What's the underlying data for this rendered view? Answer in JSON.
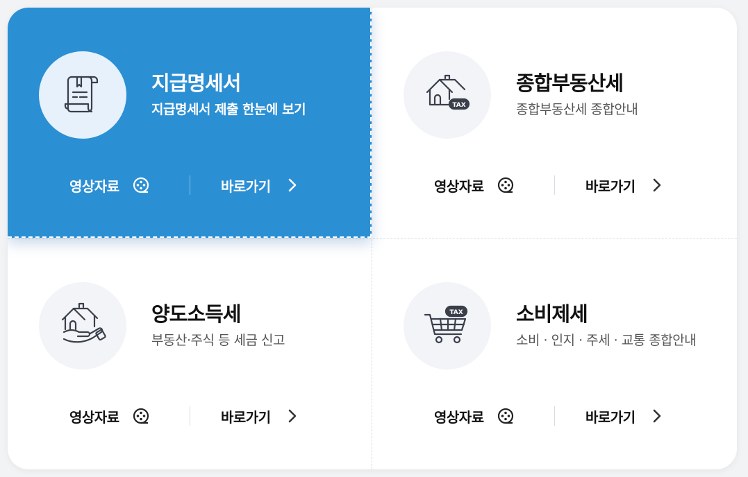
{
  "cards": [
    {
      "title": "지급명세서",
      "desc": "지급명세서 제출 한눈에 보기",
      "icon": "document-scroll-icon",
      "video_label": "영상자료",
      "go_label": "바로가기",
      "active": true
    },
    {
      "title": "종합부동산세",
      "desc": "종합부동산세 종합안내",
      "icon": "house-tax-icon",
      "tax_badge": "TAX",
      "video_label": "영상자료",
      "go_label": "바로가기",
      "active": false
    },
    {
      "title": "양도소득세",
      "desc": "부동산·주식 등 세금 신고",
      "icon": "house-in-hand-icon",
      "video_label": "영상자료",
      "go_label": "바로가기",
      "active": false
    },
    {
      "title": "소비제세",
      "desc": "소비 · 인지 · 주세 · 교통 종합안내",
      "icon": "shopping-cart-tax-icon",
      "tax_badge": "TAX",
      "video_label": "영상자료",
      "go_label": "바로가기",
      "active": false
    }
  ],
  "colors": {
    "active_bg": "#2b8fd4",
    "icon_circle_bg": "#f2f4f8",
    "text_dark": "#111111",
    "text_sub": "#555555"
  }
}
